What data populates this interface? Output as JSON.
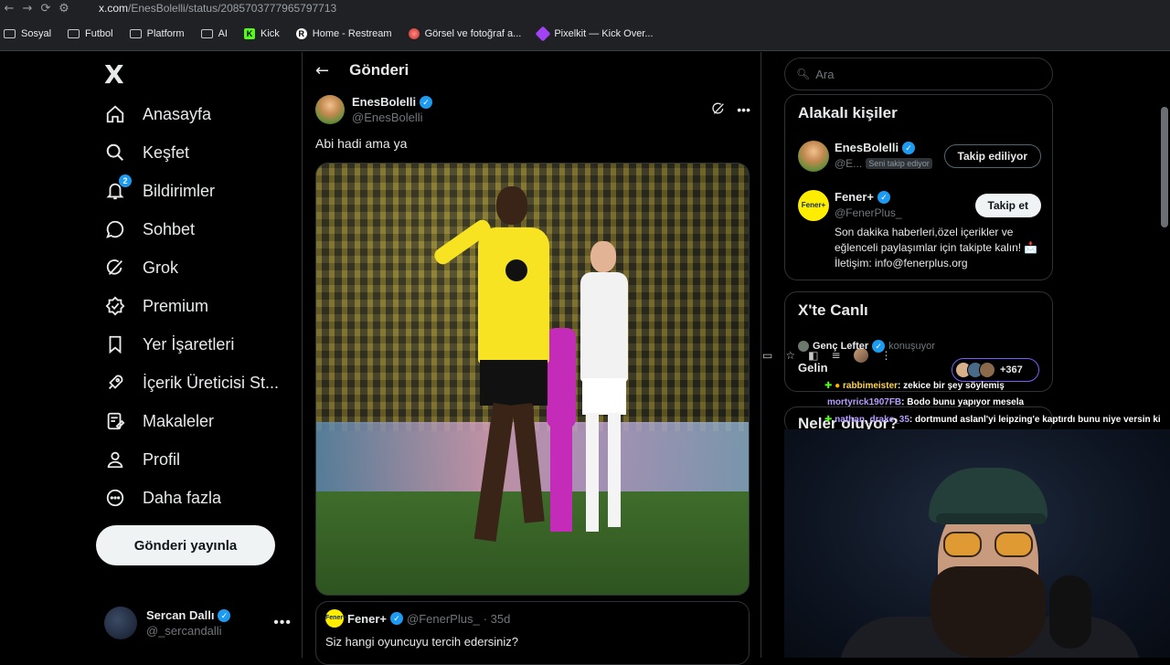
{
  "browser": {
    "url_host": "x.com",
    "url_path": "/EnesBolelli/status/2085703777965797713",
    "bookmarks": [
      {
        "label": "Sosyal",
        "icon": "folder-icon"
      },
      {
        "label": "Futbol",
        "icon": "folder-icon"
      },
      {
        "label": "Platform",
        "icon": "folder-icon"
      },
      {
        "label": "AI",
        "icon": "folder-icon"
      },
      {
        "label": "Kick",
        "icon": "kick-icon"
      },
      {
        "label": "Home - Restream",
        "icon": "restream-icon"
      },
      {
        "label": "Görsel ve fotoğraf a...",
        "icon": "gallery-icon"
      },
      {
        "label": "Pixelkit — Kick Over...",
        "icon": "pixelkit-icon"
      }
    ]
  },
  "sidebar": {
    "logo": "X",
    "items": [
      {
        "label": "Anasayfa",
        "icon": "home-icon"
      },
      {
        "label": "Keşfet",
        "icon": "search-icon"
      },
      {
        "label": "Bildirimler",
        "icon": "bell-icon",
        "badge": "2"
      },
      {
        "label": "Sohbet",
        "icon": "chat-icon"
      },
      {
        "label": "Grok",
        "icon": "grok-icon"
      },
      {
        "label": "Premium",
        "icon": "premium-icon"
      },
      {
        "label": "Yer İşaretleri",
        "icon": "bookmark-icon"
      },
      {
        "label": "İçerik Üreticisi St...",
        "icon": "rocket-icon"
      },
      {
        "label": "Makaleler",
        "icon": "article-icon"
      },
      {
        "label": "Profil",
        "icon": "profile-icon"
      },
      {
        "label": "Daha fazla",
        "icon": "more-icon"
      }
    ],
    "post_button": "Gönderi yayınla",
    "account": {
      "name": "Sercan Dallı",
      "handle": "@_sercandalli"
    }
  },
  "main": {
    "header_title": "Gönderi",
    "tweet": {
      "author": "EnesBolelli",
      "handle": "@EnesBolelli",
      "text": "Abi hadi ama ya"
    },
    "quote": {
      "author": "Fener+",
      "avatar_text": "Fener+",
      "handle": "@FenerPlus_",
      "time": "· 35d",
      "text": "Siz hangi oyuncuyu tercih edersiniz?"
    }
  },
  "right": {
    "search_placeholder": "Ara",
    "relevant": {
      "title": "Alakalı kişiler",
      "people": [
        {
          "name": "EnesBolelli",
          "handle": "@E...",
          "tag": "Seni takip ediyor",
          "button": "Takip ediliyor"
        },
        {
          "name": "Fener+",
          "handle": "@FenerPlus_",
          "avatar_text": "Fener+",
          "button": "Takip et",
          "bio": "Son dakika haberleri,özel içerikler ve eğlenceli paylaşımlar için takipte kalın! 📩 İletişim: info@fenerplus.org"
        }
      ]
    },
    "live": {
      "title": "X'te Canlı",
      "host": "Genç Lefter",
      "status": "konuşuyor",
      "room": "Gelin",
      "count": "+367"
    },
    "next_title": "Neler oluyor?"
  },
  "chat": [
    {
      "user": "rabbimeister",
      "msg": ": zekice bir şey söylemiş"
    },
    {
      "user": "mortyrick1907FB",
      "msg": ": Bodo bunu yapıyor mesela"
    },
    {
      "user": "nathan_drake_35",
      "msg": ": dortmund aslanl'yi leipzing'e kaptırdı bunu niye versin ki"
    }
  ],
  "colors": {
    "accent": "#1d9bf0",
    "background": "#000000",
    "border": "#2f3336",
    "stream_user": "#b69cff"
  }
}
